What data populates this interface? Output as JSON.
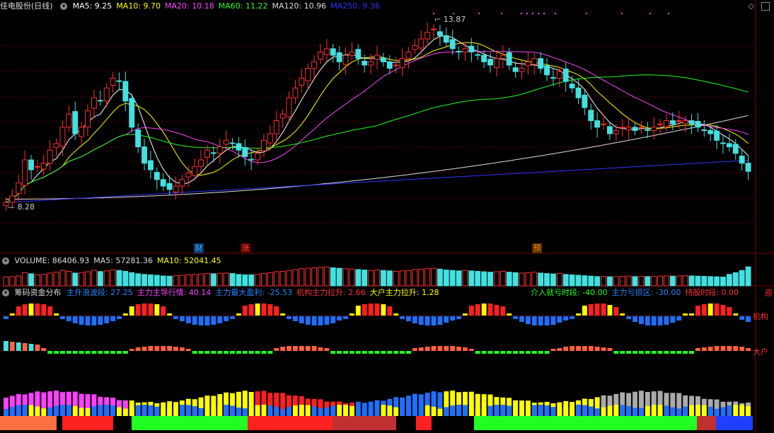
{
  "price_panel": {
    "title": "佳电股份(日线)",
    "ma": [
      {
        "label": "MA5: 9.25",
        "color": "#ffffff"
      },
      {
        "label": "MA10: 9.70",
        "color": "#ffff00"
      },
      {
        "label": "MA20: 10.18",
        "color": "#ff44ff"
      },
      {
        "label": "MA60: 11.22",
        "color": "#22ff22"
      },
      {
        "label": "MA120: 10.96",
        "color": "#dddddd"
      },
      {
        "label": "MA250: 9.36",
        "color": "#3333ff"
      }
    ],
    "high_label": "13.87",
    "low_label": "8.28",
    "event_tags": [
      {
        "text": "财",
        "color": "#55aaff"
      },
      {
        "text": "涨",
        "color": "#ff4040"
      },
      {
        "text": "预",
        "color": "#ff8800"
      }
    ]
  },
  "volume_panel": {
    "items": [
      {
        "label": "VOLUME: 86406.93",
        "color": "#dddddd"
      },
      {
        "label": "MA5: 57281.36",
        "color": "#dddddd"
      },
      {
        "label": "MA10: 52041.45",
        "color": "#ffff00"
      }
    ]
  },
  "chip_panel": {
    "title": "筹码资金分布",
    "items": [
      {
        "label": "主升浪波段: 27.25",
        "color": "#2288ff"
      },
      {
        "label": "主力主导行情: 40.14",
        "color": "#ff44ff"
      },
      {
        "label": "主力最大盈利: -25.53",
        "color": "#2288ff"
      },
      {
        "label": "机构主力拉升: 2.66",
        "color": "#ff3030"
      },
      {
        "label": "大户主力拉升: 1.28",
        "color": "#ffff00"
      }
    ],
    "right_items": [
      {
        "label": "介入就亏时段: -40.00",
        "color": "#22ff22"
      },
      {
        "label": "主力亏损区: -30.00",
        "color": "#2288ff"
      },
      {
        "label": "持股时段: 0.00",
        "color": "#ff3030"
      }
    ],
    "edge_label": "原",
    "row_label_1": "机构",
    "row_label_2": "大户"
  },
  "chart_data": {
    "type": "candlestick",
    "title": "佳电股份(日线)",
    "price_range": [
      8.28,
      13.87
    ],
    "close": [
      8.3,
      8.5,
      8.9,
      9.6,
      9.3,
      9.4,
      9.5,
      9.9,
      10.1,
      10.6,
      11.0,
      10.4,
      10.6,
      11.1,
      11.5,
      11.4,
      11.8,
      12.1,
      12.0,
      11.4,
      10.6,
      10.0,
      9.5,
      9.3,
      9.0,
      8.8,
      8.7,
      8.8,
      9.0,
      9.2,
      9.4,
      9.6,
      9.9,
      9.8,
      10.0,
      10.2,
      10.1,
      9.9,
      9.7,
      9.6,
      9.8,
      10.2,
      10.4,
      10.8,
      11.0,
      11.5,
      11.8,
      12.1,
      12.4,
      12.6,
      12.9,
      13.0,
      12.8,
      12.6,
      12.8,
      12.9,
      12.7,
      12.5,
      12.6,
      12.8,
      12.6,
      12.4,
      12.5,
      12.7,
      12.9,
      13.1,
      13.3,
      13.5,
      13.6,
      13.4,
      13.2,
      13.0,
      12.9,
      13.0,
      12.9,
      12.8,
      12.6,
      12.5,
      12.7,
      12.8,
      12.5,
      12.3,
      12.4,
      12.6,
      12.7,
      12.4,
      12.2,
      12.1,
      12.3,
      12.0,
      11.8,
      11.5,
      11.2,
      10.8,
      10.6,
      10.7,
      10.4,
      10.5,
      10.6,
      10.6,
      10.5,
      10.6,
      10.5,
      10.6,
      10.7,
      10.8,
      10.7,
      10.8,
      10.8,
      10.7,
      10.6,
      10.5,
      10.4,
      10.2,
      10.1,
      10.0,
      9.8,
      9.5,
      9.25
    ],
    "volume": [
      40,
      42,
      45,
      60,
      55,
      50,
      52,
      58,
      62,
      70,
      66,
      58,
      60,
      64,
      70,
      65,
      68,
      72,
      70,
      66,
      60,
      55,
      52,
      50,
      48,
      45,
      44,
      46,
      48,
      50,
      52,
      54,
      56,
      55,
      57,
      58,
      56,
      52,
      50,
      50,
      52,
      56,
      60,
      64,
      66,
      70,
      74,
      78,
      80,
      82,
      84,
      86,
      82,
      80,
      78,
      76,
      74,
      72,
      70,
      72,
      70,
      68,
      66,
      68,
      70,
      74,
      76,
      78,
      80,
      76,
      72,
      70,
      68,
      70,
      68,
      66,
      64,
      62,
      64,
      66,
      62,
      60,
      58,
      60,
      62,
      58,
      56,
      54,
      56,
      52,
      50,
      48,
      46,
      44,
      42,
      43,
      41,
      42,
      43,
      44,
      42,
      43,
      42,
      43,
      44,
      45,
      44,
      45,
      46,
      45,
      44,
      43,
      42,
      41,
      40,
      52,
      60,
      70,
      86.4
    ],
    "ma_lines": [
      "MA5",
      "MA10",
      "MA20",
      "MA60",
      "MA120",
      "MA250"
    ]
  }
}
